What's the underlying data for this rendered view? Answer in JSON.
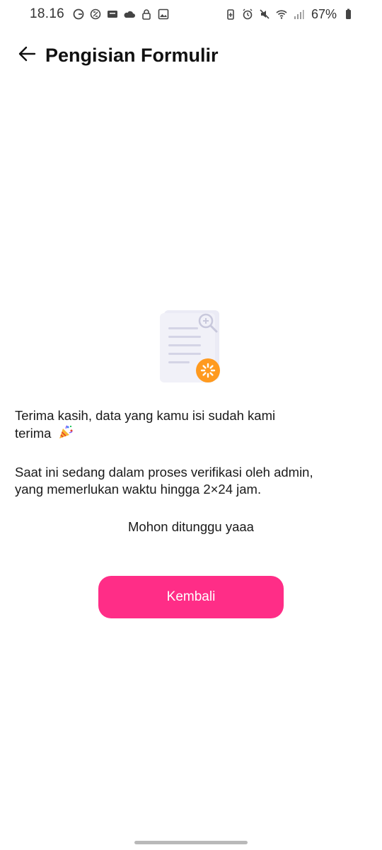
{
  "status_bar": {
    "time": "18.16",
    "battery_percent": "67%",
    "left_icons": [
      "g-icon",
      "sync-icon",
      "ticket-icon",
      "cloud-icon",
      "lock-icon",
      "image-icon"
    ],
    "right_icons": [
      "battery-saver-icon",
      "alarm-icon",
      "mute-icon",
      "wifi-icon",
      "signal-icon",
      "battery-icon"
    ]
  },
  "app_bar": {
    "title": "Pengisian Formulir",
    "back_icon": "arrow-left-icon"
  },
  "illustration": {
    "icon": "document-review-icon",
    "accent_color": "#ff9a1f"
  },
  "messages": {
    "thanks_line": "Terima kasih, data yang kamu isi sudah kami",
    "thanks_line2": "terima",
    "thanks_emoji": "party-popper-icon",
    "verify_line1": "Saat ini sedang dalam proses verifikasi oleh admin,",
    "verify_line2": "yang memerlukan waktu hingga 2×24 jam.",
    "wait": "Mohon ditunggu yaaa"
  },
  "button": {
    "label": "Kembali",
    "color": "#ff2d87"
  }
}
